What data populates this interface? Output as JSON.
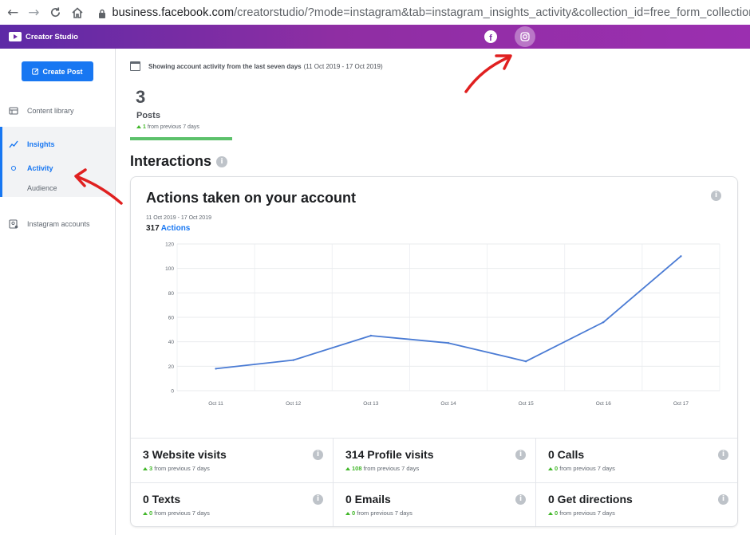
{
  "browser": {
    "url_host": "business.facebook.com",
    "url_path": "/creatorstudio/?mode=instagram&tab=instagram_insights_activity&collection_id=free_form_collection"
  },
  "header": {
    "title": "Creator Studio"
  },
  "sidebar": {
    "create_post": "Create Post",
    "items": [
      {
        "label": "Content library",
        "icon": "content-library-icon"
      },
      {
        "label": "Insights",
        "icon": "insights-icon"
      },
      {
        "label": "Activity"
      },
      {
        "label": "Audience"
      },
      {
        "label": "Instagram accounts",
        "icon": "instagram-accounts-icon"
      }
    ]
  },
  "main": {
    "range_label": "Showing account activity from the last seven days",
    "range_dates": "(11 Oct 2019 - 17 Oct 2019)",
    "posts": {
      "count": "3",
      "label": "Posts",
      "delta": "1",
      "delta_text": "from previous 7 days"
    },
    "interactions_title": "Interactions",
    "card": {
      "title": "Actions taken on your account",
      "dates": "11 Oct 2019 - 17 Oct 2019",
      "total": "317",
      "total_label": "Actions"
    },
    "stats": [
      {
        "name": "3 Website visits",
        "delta": "3",
        "delta_text": "from previous 7 days"
      },
      {
        "name": "314 Profile visits",
        "delta": "108",
        "delta_text": "from previous 7 days"
      },
      {
        "name": "0 Calls",
        "delta": "0",
        "delta_text": "from previous 7 days"
      },
      {
        "name": "0 Texts",
        "delta": "0",
        "delta_text": "from previous 7 days"
      },
      {
        "name": "0 Emails",
        "delta": "0",
        "delta_text": "from previous 7 days"
      },
      {
        "name": "0 Get directions",
        "delta": "0",
        "delta_text": "from previous 7 days"
      }
    ]
  },
  "chart_data": {
    "type": "line",
    "categories": [
      "Oct 11",
      "Oct 12",
      "Oct 13",
      "Oct 14",
      "Oct 15",
      "Oct 16",
      "Oct 17"
    ],
    "series": [
      {
        "values": [
          18,
          25,
          45,
          39,
          24,
          56,
          110
        ]
      }
    ],
    "yticks": [
      0,
      20,
      40,
      60,
      80,
      100,
      120
    ],
    "ylim": [
      0,
      120
    ],
    "grid": true,
    "color": "#4a7bd4"
  },
  "colors": {
    "accent": "#1877f2",
    "positive": "#42b72a",
    "header_start": "#5d2aa6",
    "header_end": "#9b2fb0"
  }
}
